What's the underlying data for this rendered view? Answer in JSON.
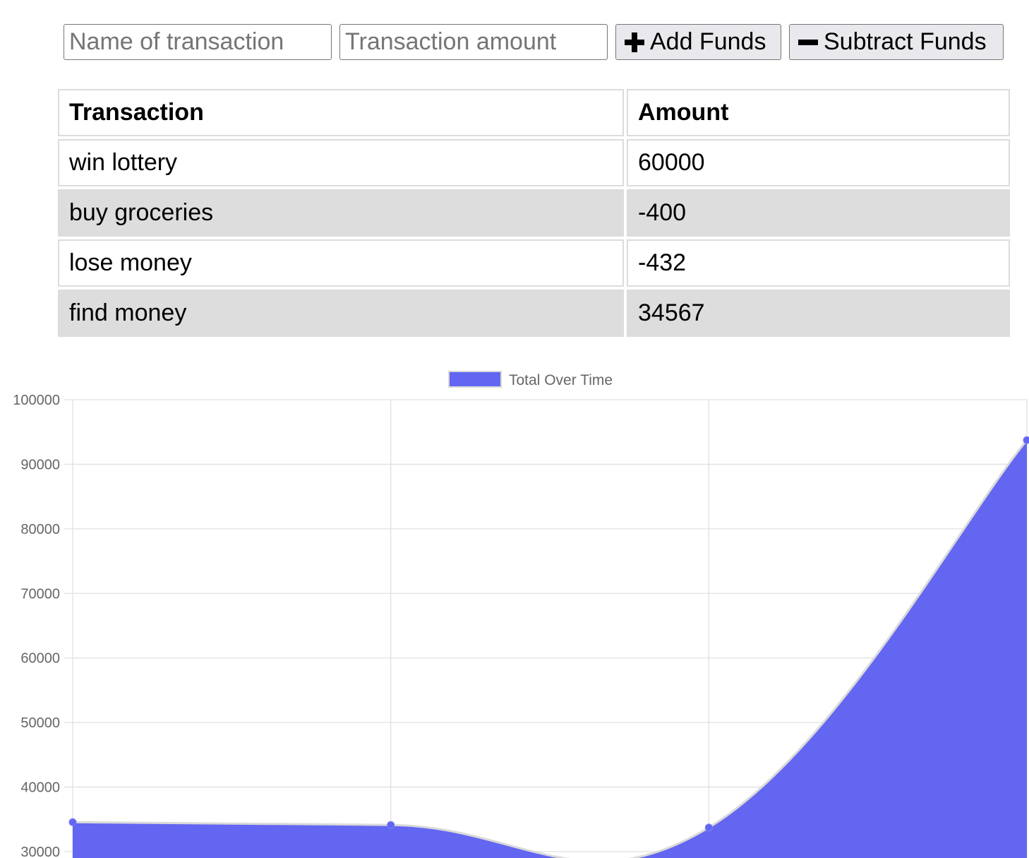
{
  "form": {
    "name_placeholder": "Name of transaction",
    "amount_placeholder": "Transaction amount",
    "add_label": "Add Funds",
    "subtract_label": "Subtract Funds"
  },
  "table": {
    "headers": [
      "Transaction",
      "Amount"
    ],
    "rows": [
      {
        "name": "win lottery",
        "amount": "60000"
      },
      {
        "name": "buy groceries",
        "amount": "-400"
      },
      {
        "name": "lose money",
        "amount": "-432"
      },
      {
        "name": "find money",
        "amount": "34567"
      }
    ]
  },
  "colors": {
    "series_fill": "#6366f1",
    "grid": "#e0e0e0",
    "row_alt": "#dddddd"
  },
  "chart_data": {
    "type": "area",
    "x": [
      "",
      "",
      "",
      ""
    ],
    "series": [
      {
        "name": "Total Over Time",
        "values": [
          34567,
          34135,
          33735,
          93735
        ]
      }
    ],
    "ylim": [
      30000,
      100000
    ],
    "yticks": [
      "30000",
      "40000",
      "50000",
      "60000",
      "70000",
      "80000",
      "90000",
      "100000"
    ],
    "legend_position": "top-center",
    "grid": true
  }
}
